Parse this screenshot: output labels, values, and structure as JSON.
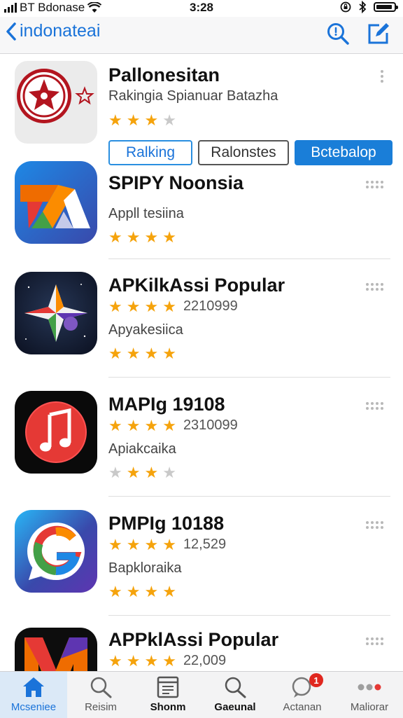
{
  "status_bar": {
    "carrier": "BT Bdonase",
    "time": "3:28"
  },
  "nav": {
    "back_label": "indonateai"
  },
  "segments": [
    "Ralking",
    "Ralonstes",
    "Bctebalop"
  ],
  "apps": [
    {
      "name": "Pallonesitan",
      "subtitle": "Rakingia Spianuar Batazha",
      "rating": 3,
      "count": "",
      "stars_row2": null,
      "icon": "red-seal-icon"
    },
    {
      "name": "SPIPY Noonsia",
      "subtitle": "Appll tesiina",
      "rating": null,
      "count": "",
      "stars_row2": 4,
      "icon": "blue-z-icon"
    },
    {
      "name": "APKilkAssi Popular",
      "subtitle": "Apyakesiica",
      "rating": 4,
      "count": "2210999",
      "stars_row2": 4,
      "icon": "sparkle-star-icon"
    },
    {
      "name": "MAPIg 19108",
      "subtitle": "Apiakcaika",
      "rating": 4,
      "count": "2310099",
      "stars_row2": 3,
      "icon": "music-note-icon"
    },
    {
      "name": "PMPIg 10188",
      "subtitle": "Bapkloraika",
      "rating": 4,
      "count": "12,529",
      "stars_row2": 4,
      "icon": "g-chat-icon"
    },
    {
      "name": "APPklAssi Popular",
      "subtitle": "",
      "rating": 4,
      "count": "22,009",
      "stars_row2": null,
      "icon": "m-logo-icon"
    }
  ],
  "tabs": [
    {
      "label": "Mcseniee",
      "icon": "home-icon",
      "active": true
    },
    {
      "label": "Reisim",
      "icon": "search-icon",
      "active": false
    },
    {
      "label": "Shonm",
      "icon": "window-icon",
      "active": false
    },
    {
      "label": "Gaeunal",
      "icon": "search-icon",
      "active": false
    },
    {
      "label": "Actanan",
      "icon": "chat-icon",
      "active": false,
      "badge": "1"
    },
    {
      "label": "Maliorar",
      "icon": "more-dots-icon",
      "active": false
    }
  ]
}
